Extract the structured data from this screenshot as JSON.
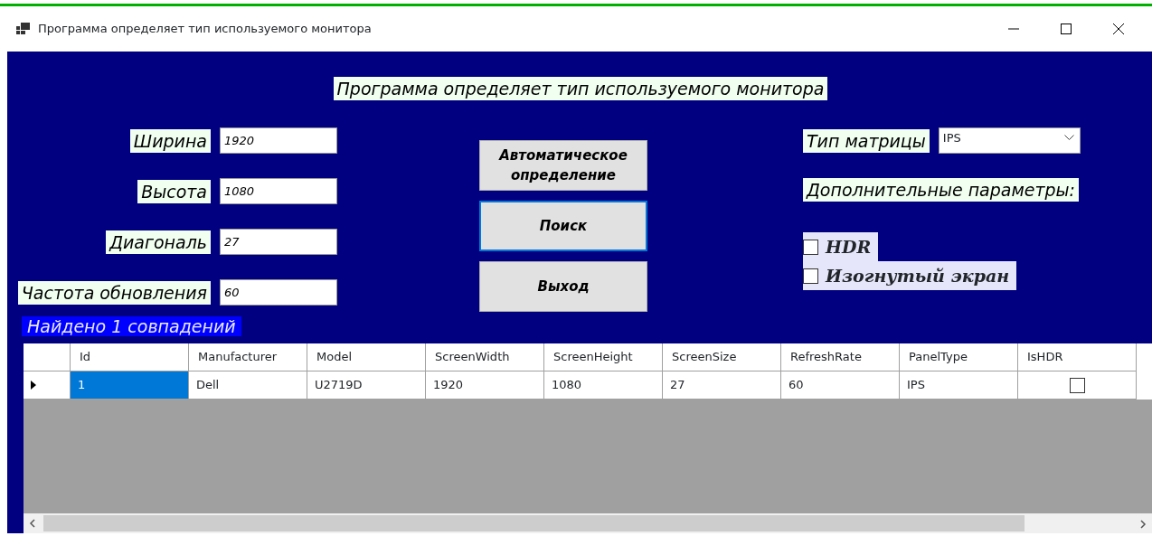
{
  "window": {
    "title": "Программа определяет тип используемого монитора"
  },
  "heading": "Программа определяет тип используемого монитора",
  "fields": [
    {
      "label": "Ширина",
      "value": "1920"
    },
    {
      "label": "Высота",
      "value": "1080"
    },
    {
      "label": "Диагональ",
      "value": "27"
    },
    {
      "label": "Частота обновления",
      "value": "60"
    }
  ],
  "buttons": [
    {
      "label": "Автоматическое определение",
      "focused": false
    },
    {
      "label": "Поиск",
      "focused": true
    },
    {
      "label": "Выход",
      "focused": false
    }
  ],
  "matrix": {
    "label": "Тип матрицы",
    "value": "IPS"
  },
  "extra_label": "Дополнительные параметры:",
  "options": [
    {
      "label": "HDR",
      "checked": false
    },
    {
      "label": "Изогнутый экран",
      "checked": false
    }
  ],
  "result": "Найдено 1  совпадений",
  "table": {
    "columns": [
      "Id",
      "Manufacturer",
      "Model",
      "ScreenWidth",
      "ScreenHeight",
      "ScreenSize",
      "RefreshRate",
      "PanelType",
      "IsHDR"
    ],
    "rows": [
      {
        "current": true,
        "cells": [
          {
            "kind": "text",
            "text": "1",
            "selected": true
          },
          {
            "kind": "text",
            "text": "Dell",
            "selected": false
          },
          {
            "kind": "text",
            "text": "U2719D",
            "selected": false
          },
          {
            "kind": "text",
            "text": "1920",
            "selected": false
          },
          {
            "kind": "text",
            "text": "1080",
            "selected": false
          },
          {
            "kind": "text",
            "text": "27",
            "selected": false
          },
          {
            "kind": "text",
            "text": "60",
            "selected": false
          },
          {
            "kind": "text",
            "text": "IPS",
            "selected": false
          },
          {
            "kind": "check",
            "checked": false,
            "selected": false
          }
        ]
      }
    ]
  }
}
